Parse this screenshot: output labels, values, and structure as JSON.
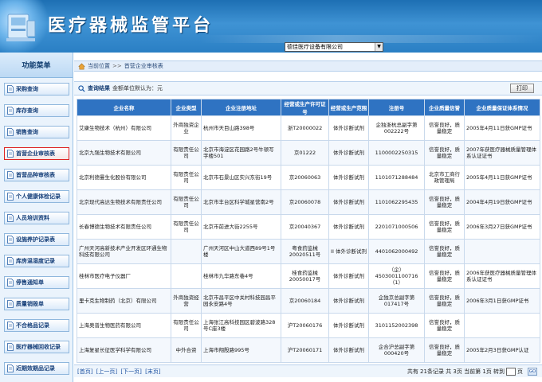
{
  "header": {
    "title": "医疗器械监管平台",
    "company_select": "德佳医疗设备有限公司"
  },
  "sidebar": {
    "heading": "功能菜单",
    "items": [
      {
        "label": "采购查询",
        "active": false
      },
      {
        "label": "库存查询",
        "active": false
      },
      {
        "label": "销售查询",
        "active": false
      },
      {
        "label": "首营企业审核表",
        "active": true
      },
      {
        "label": "首营品种审核表",
        "active": false
      },
      {
        "label": "个人健康体检记录",
        "active": false
      },
      {
        "label": "人员培训资料",
        "active": false
      },
      {
        "label": "设施养护记录表",
        "active": false
      },
      {
        "label": "库房温湿度记录",
        "active": false
      },
      {
        "label": "停售通知单",
        "active": false
      },
      {
        "label": "质量销毁单",
        "active": false
      },
      {
        "label": "不合格品记录",
        "active": false
      },
      {
        "label": "医疗器械回收记录",
        "active": false
      },
      {
        "label": "近期效期品记录",
        "active": false
      }
    ]
  },
  "breadcrumb": {
    "location": "当前位置",
    "separator": ">>",
    "page": "首营企业审核表"
  },
  "results_bar": {
    "label": "查询结果",
    "detail": "金额单位默认为：元",
    "print_label": "打印"
  },
  "table": {
    "columns": [
      "企业名称",
      "企业类型",
      "企业注册地址",
      "经营或生产许可证号",
      "经营或生产范围",
      "注册号",
      "企业质量信誉",
      "企业质量保证体系情况"
    ],
    "rows": [
      [
        "艾康生物技术（杭州）有限公司",
        "外商独资企业",
        "杭州市天目山路398号",
        "浙T20000022",
        "体外诊断试剂",
        "企独浙杭总副字第002222号",
        "信誉良好，质量稳定",
        "2005年4月11日获GMP证书"
      ],
      [
        "北京九强生物技术有限公司",
        "有限责任公司",
        "北京市海淀区花园路2号牛顿写字楼501",
        "京01222",
        "体外诊断试剂",
        "1100002250315",
        "信誉良好，质量稳定",
        "2007年获医疗器械质量管理体系认证证书"
      ],
      [
        "北京利德曼生化股份有限公司",
        "有限责任公司",
        "北京市石景山区实兴东街19号",
        "京20060063",
        "体外诊断试剂",
        "1101071288484",
        "北京市工商行政管理局",
        "2005年4月11日获GMP证书"
      ],
      [
        "北京现代高达生物技术有限责任公司",
        "有限责任公司",
        "北京市丰台区科学城星营南2号",
        "京20060078",
        "体外诊断试剂",
        "1101062295435",
        "信誉良好，质量稳定",
        "2004年4月19日获GMP证书"
      ],
      [
        "长春博德生物技术有限责任公司",
        "有限责任公司",
        "北京市前进大街2255号",
        "京20040367",
        "体外诊断试剂",
        "2201071000506",
        "信誉良好，质量稳定",
        "2006年3月27日获GMP证书"
      ],
      [
        "广州天河高新技术产业开发区环通生物科技有限公司",
        "",
        "广州天河区中山大道西89号1号楼",
        "粤食药监械20020511号",
        "II 体外诊断试剂",
        "4401062000492",
        "信誉良好，质量稳定",
        ""
      ],
      [
        "桂林市医疗电子仪器厂",
        "",
        "桂林市九华路东巷4号",
        "桂食药监械20050017号",
        "体外诊断试剂",
        "（企）4503001100716（1）",
        "信誉良好，质量稳定",
        "2006年获医疗器械质量管理体系认证证书"
      ],
      [
        "里卡克生物制药（北京）有限公司",
        "外商独资经营",
        "北京市昌平区中关村科技园昌平园永安路4号",
        "京20060184",
        "体外诊断试剂",
        "企独京总副字第017417号",
        "信誉良好，质量稳定",
        "2006年3月1日获GMP证书"
      ],
      [
        "上海奥普生物医药有限公司",
        "有限责任公司",
        "上海张江高科技园区碧波路328号C座3楼",
        "沪T20060176",
        "体外诊断试剂",
        "3101152002398",
        "信誉良好，质量稳定",
        ""
      ],
      [
        "上海复星长征医学科学有限公司",
        "中外合资",
        "上海市翔殷路995号",
        "沪T20060171",
        "体外诊断试剂",
        "企合沪总副字第000420号",
        "信誉良好，质量稳定",
        "2005年2月3日获GMP认证"
      ]
    ]
  },
  "pager": {
    "first": "[首页]",
    "prev": "[上一页]",
    "next": "[下一页]",
    "last": "[末页]",
    "info": "共有 21条记录 共 3页 当前第 1页 转到",
    "page_suffix": "页",
    "go": "GO"
  }
}
